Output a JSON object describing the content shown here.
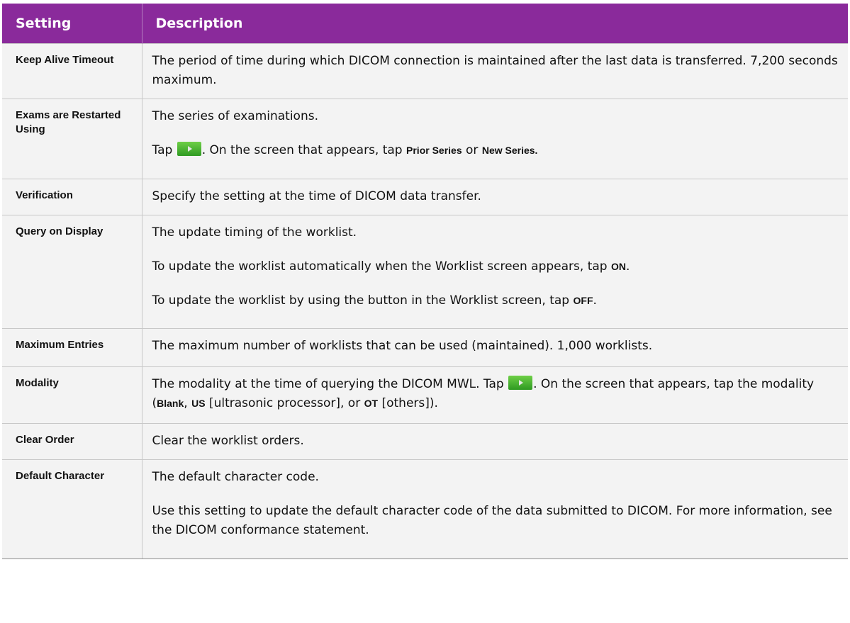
{
  "header": {
    "setting": "Setting",
    "description": "Description"
  },
  "rows": {
    "keep_alive": {
      "setting": "Keep Alive Timeout",
      "d1": "The period of time during which DICOM connection is maintained after the last data is transferred. 7,200 seconds maximum."
    },
    "exams": {
      "setting": "Exams are Restarted Using",
      "d1": "The series of examinations.",
      "d2_a": "Tap",
      "d2_b": ". On the screen that appears, tap",
      "d2_prior": "Prior Series",
      "d2_or": "or",
      "d2_new": "New Series."
    },
    "verification": {
      "setting": "Verification",
      "d1": "Specify the setting at the time of DICOM data transfer."
    },
    "query": {
      "setting": "Query on Display",
      "d1": "The update timing of the worklist.",
      "d2_a": "To update the worklist automatically when the Worklist screen appears, tap",
      "d2_on": "ON",
      "d2_end": ".",
      "d3_a": "To update the worklist by using the button in the Worklist screen, tap",
      "d3_off": "OFF",
      "d3_end": "."
    },
    "max_entries": {
      "setting": "Maximum Entries",
      "d1": "The maximum number of worklists that can be used (maintained). 1,000 worklists."
    },
    "modality": {
      "setting": "Modality",
      "d1_a": "The modality at the time of querying the DICOM MWL. Tap",
      "d1_b": ". On the screen that appears, tap the modality (",
      "d1_blank": "Blank",
      "d1_c": ",",
      "d1_us": "US",
      "d1_d": "[ultrasonic processor], or",
      "d1_ot": "OT",
      "d1_e": "[others])."
    },
    "clear_order": {
      "setting": "Clear Order",
      "d1": "Clear the worklist orders."
    },
    "default_char": {
      "setting": "Default Character",
      "d1": "The default character code.",
      "d2": "Use this setting to update the default character code of the data submitted to DICOM. For more information, see the DICOM conformance statement."
    }
  },
  "icons": {
    "arrow_button": "play-arrow-icon"
  },
  "colors": {
    "header_bg": "#8a2a9b",
    "row_bg": "#f3f3f3",
    "button_green": "#3fa82d"
  }
}
